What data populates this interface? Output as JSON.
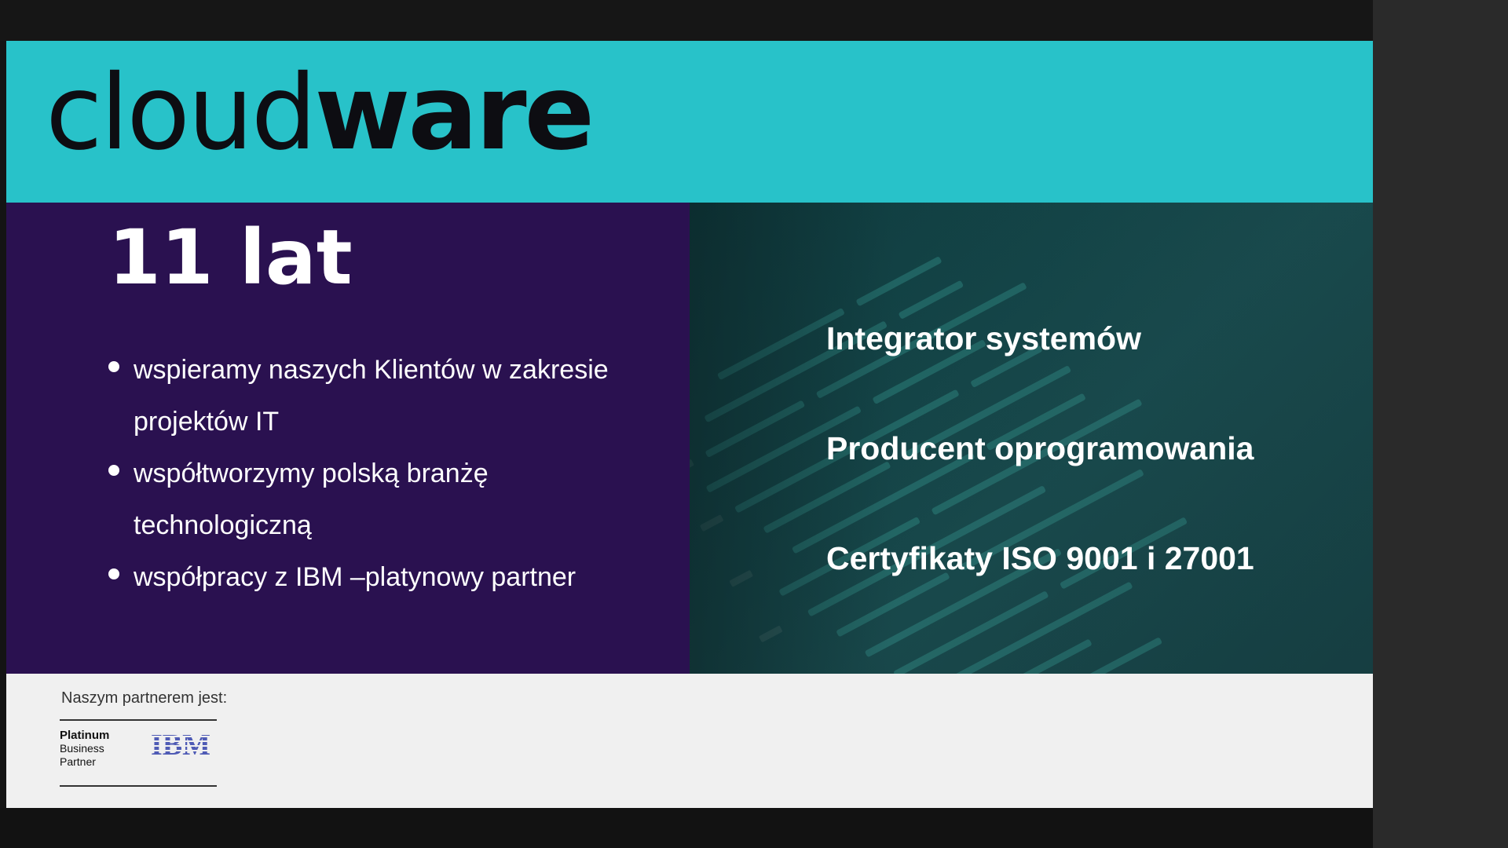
{
  "slide": {
    "logo": {
      "light": "cloud",
      "bold": "ware"
    },
    "title": "11 lat",
    "bullets": [
      "wspieramy naszych Klientów w zakresie projektów IT",
      "współtworzymy polską branżę technologiczną",
      "współpracy z IBM –platynowy partner"
    ],
    "features": [
      "Integrator systemów",
      "Producent oprogramowania",
      "Certyfikaty ISO 9001 i 27001"
    ],
    "footer": {
      "partner_label": "Naszym partnerem jest:",
      "badge": {
        "line1": "Platinum",
        "line2": "Business",
        "line3": "Partner"
      },
      "partner_logo": "IBM"
    }
  },
  "colors": {
    "header": "#28c2c9",
    "left_panel": "#2a1150",
    "right_panel": "#15484b",
    "footer": "#f0f0f0",
    "ibm_blue": "#4f5bb5"
  },
  "icons": [
    "bullet-dot-icon",
    "ibm-logo-icon"
  ]
}
